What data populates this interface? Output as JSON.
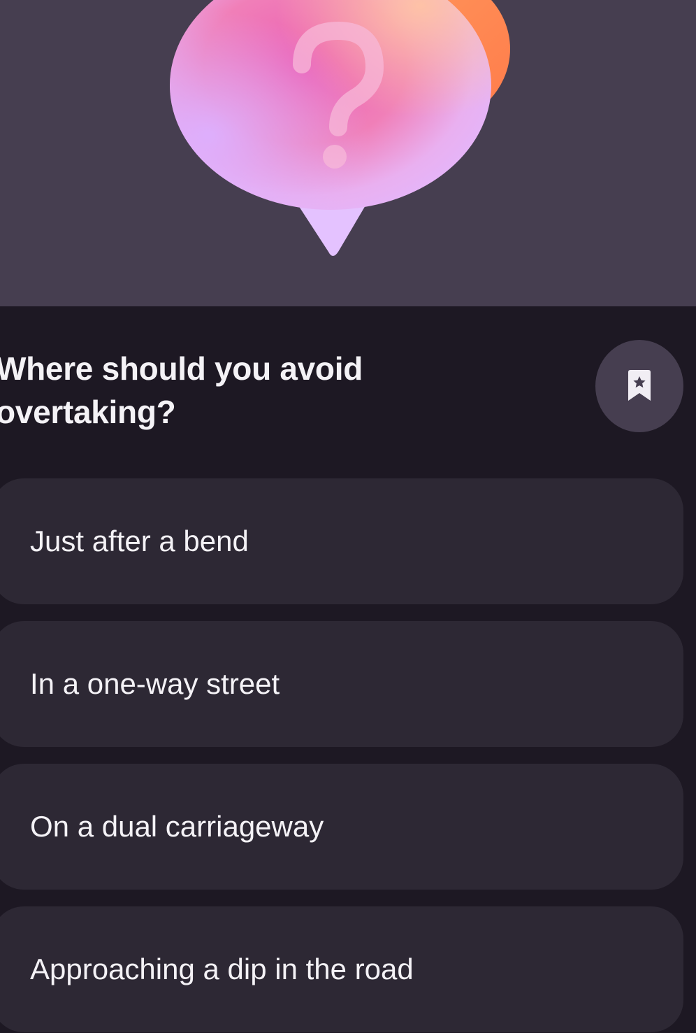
{
  "hero": {
    "illustration_icon": "question-speech-bubble-icon",
    "glyph": "?",
    "colors": {
      "background": "#463e50",
      "bubble_pink": "#ec5fb3",
      "bubble_lavender": "#e3b3ff",
      "bubble_peach": "#ffb8a0",
      "back_bubble_orange": "#ff8a55"
    }
  },
  "question": {
    "text": "Where should you avoid overtaking?"
  },
  "bookmark": {
    "icon": "bookmark-star-icon",
    "color": "#463e50"
  },
  "answers": [
    {
      "label": "Just after a bend"
    },
    {
      "label": "In a one-way street"
    },
    {
      "label": "On a dual carriageway"
    },
    {
      "label": "Approaching a dip in the road"
    }
  ],
  "theme": {
    "page_background": "#1d1823",
    "card_background": "#2d2834",
    "text_color": "#f4f2f6"
  }
}
